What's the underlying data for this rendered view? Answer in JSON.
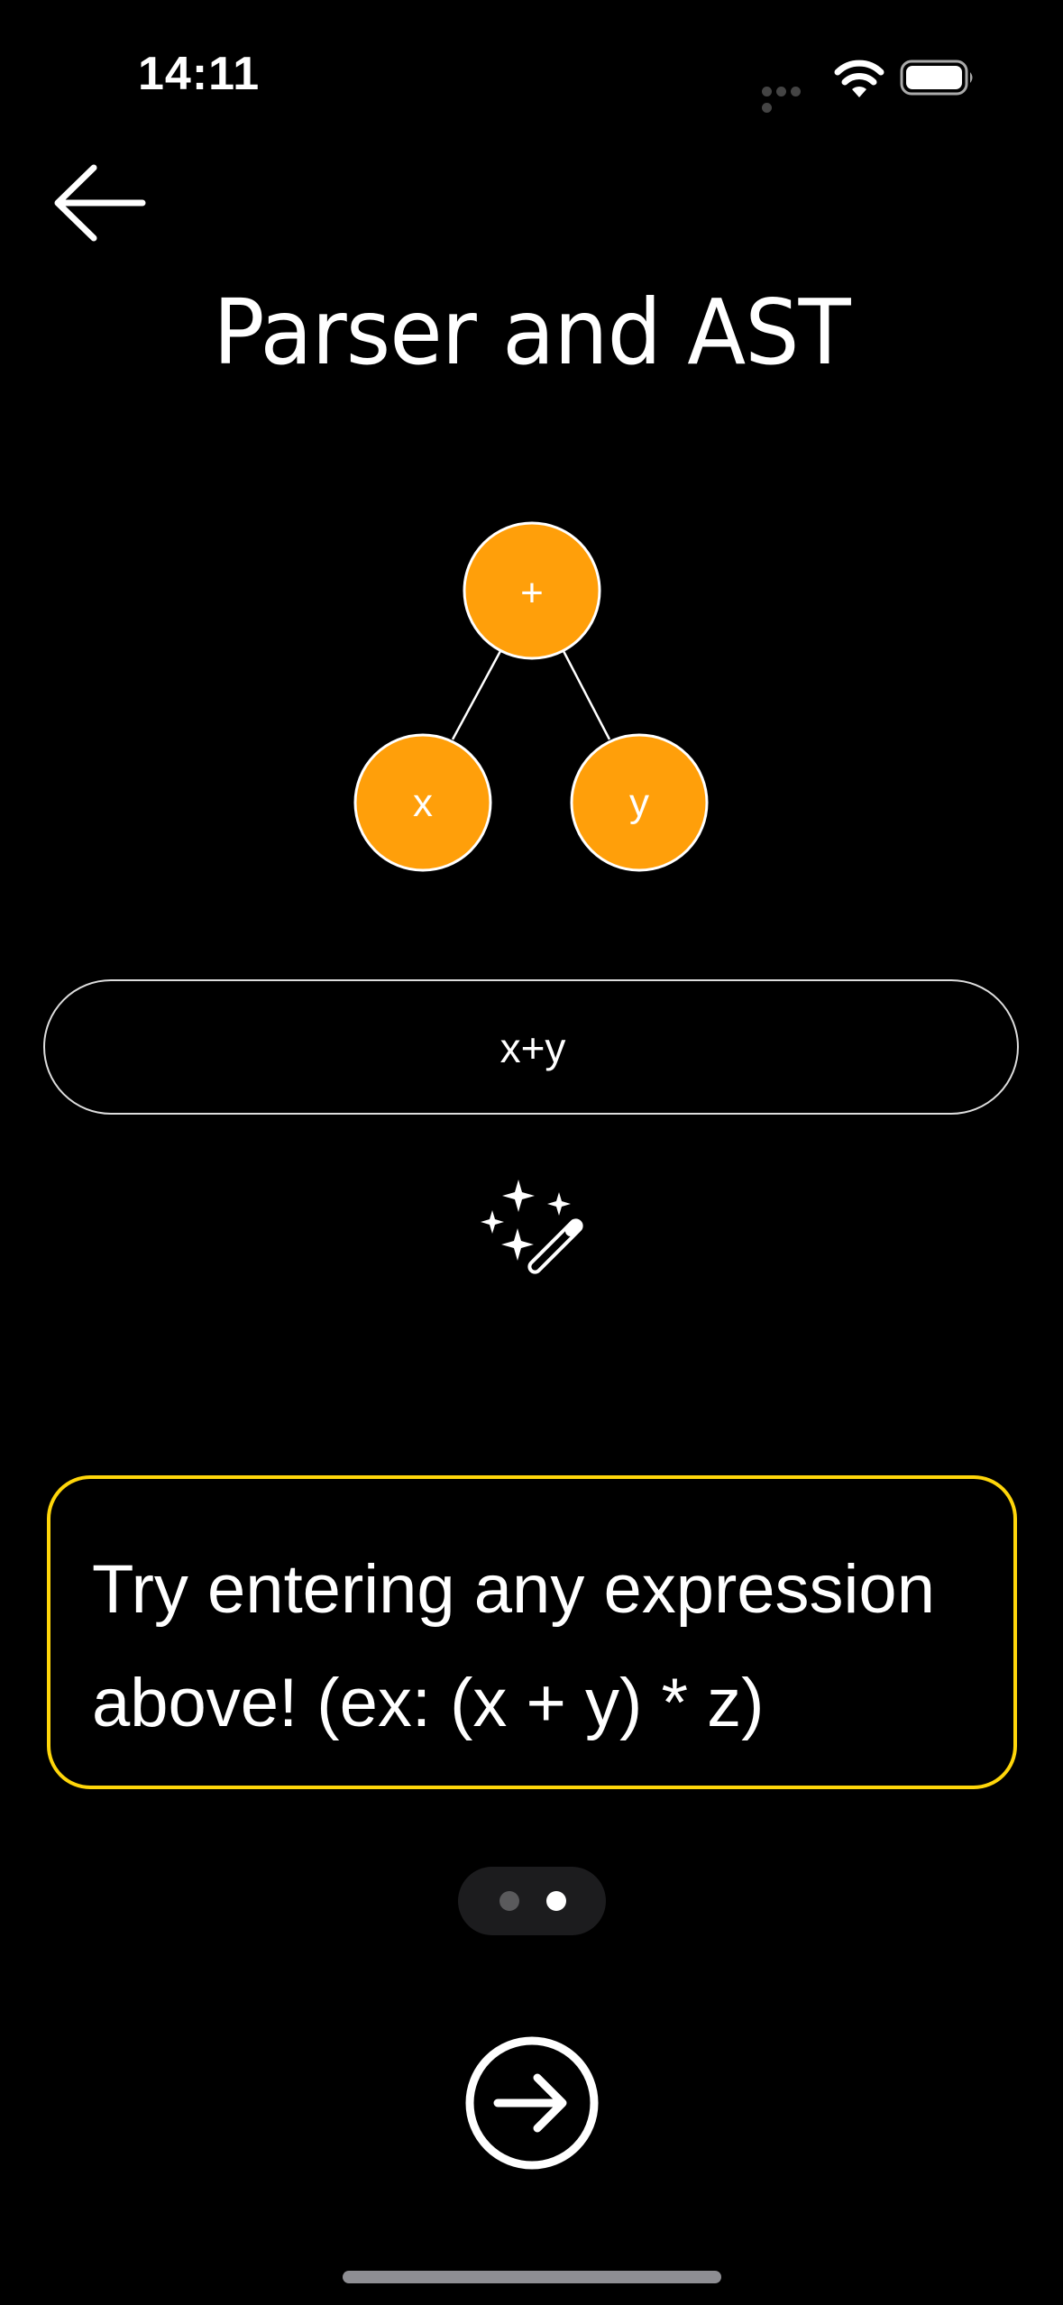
{
  "status_bar": {
    "time": "14:11"
  },
  "header": {
    "title": "Parser and AST",
    "back_icon": "arrow-left-icon"
  },
  "ast": {
    "node_color": "#ff9f0a",
    "root": "+",
    "left": "x",
    "right": "y"
  },
  "input": {
    "value": "x+y",
    "caret_color": "#30d158"
  },
  "magic_icon": "magic-wand-sparkles-icon",
  "hint": {
    "text": "Try entering any expression above! (ex: (x + y) * z)",
    "border_color": "#ffd60a"
  },
  "pager": {
    "total": 2,
    "current": 2
  },
  "next_icon": "arrow-right-circle-icon"
}
